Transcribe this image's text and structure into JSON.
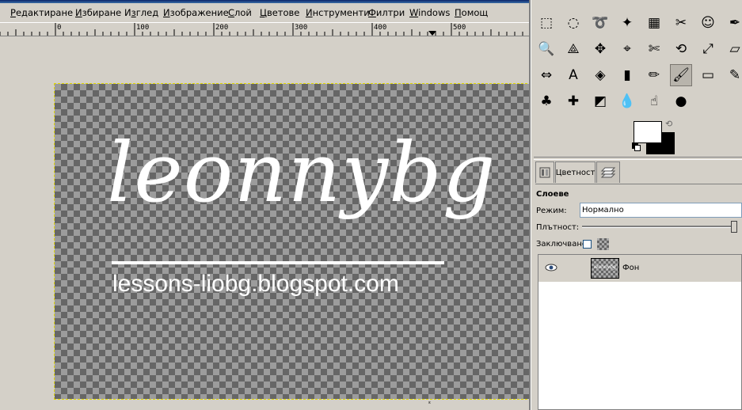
{
  "menubar": {
    "items": [
      {
        "label": "Редактиране",
        "mnemonic": "Р"
      },
      {
        "label": "Избиране",
        "mnemonic": "И"
      },
      {
        "label": "Изглед",
        "mnemonic": "з"
      },
      {
        "label": "Изображение",
        "mnemonic": "И"
      },
      {
        "label": "Слой",
        "mnemonic": "С"
      },
      {
        "label": "Цветове",
        "mnemonic": "Ц"
      },
      {
        "label": "Инструменти",
        "mnemonic": "И"
      },
      {
        "label": "Филтри",
        "mnemonic": "Ф"
      },
      {
        "label": "Windows",
        "mnemonic": "W"
      },
      {
        "label": "Помощ",
        "mnemonic": "П"
      }
    ]
  },
  "ruler": {
    "labels": [
      "0",
      "100",
      "200",
      "300",
      "400",
      "500"
    ]
  },
  "canvas": {
    "logo_text": "leonnybg",
    "url_text": "lessons-liobg.blogspot.com"
  },
  "toolbox": {
    "tools": [
      {
        "name": "rect-select-icon",
        "glyph": "⬚"
      },
      {
        "name": "ellipse-select-icon",
        "glyph": "◌"
      },
      {
        "name": "lasso-icon",
        "glyph": "➰"
      },
      {
        "name": "fuzzy-select-icon",
        "glyph": "✦"
      },
      {
        "name": "select-by-color-icon",
        "glyph": "▦"
      },
      {
        "name": "scissors-icon",
        "glyph": "✂"
      },
      {
        "name": "foreground-select-icon",
        "glyph": "☺"
      },
      {
        "name": "paths-icon",
        "glyph": "✒"
      },
      {
        "name": "magnify-icon",
        "glyph": "🔍"
      },
      {
        "name": "measure-icon",
        "glyph": "⟁"
      },
      {
        "name": "move-icon",
        "glyph": "✥"
      },
      {
        "name": "align-icon",
        "glyph": "⌖"
      },
      {
        "name": "crop-icon",
        "glyph": "✄"
      },
      {
        "name": "rotate-icon",
        "glyph": "⟲"
      },
      {
        "name": "scale-icon",
        "glyph": "⤢"
      },
      {
        "name": "shear-icon",
        "glyph": "▱"
      },
      {
        "name": "flip-icon",
        "glyph": "⇔"
      },
      {
        "name": "text-icon",
        "glyph": "A"
      },
      {
        "name": "bucket-fill-icon",
        "glyph": "◈"
      },
      {
        "name": "blend-icon",
        "glyph": "▮"
      },
      {
        "name": "pencil-icon",
        "glyph": "✏"
      },
      {
        "name": "paintbrush-icon",
        "glyph": "🖌"
      },
      {
        "name": "eraser-icon",
        "glyph": "▭"
      },
      {
        "name": "airbrush-icon",
        "glyph": "✎"
      },
      {
        "name": "clone-icon",
        "glyph": "♣"
      },
      {
        "name": "heal-icon",
        "glyph": "✚"
      },
      {
        "name": "perspective-clone-icon",
        "glyph": "◩"
      },
      {
        "name": "blur-icon",
        "glyph": "💧"
      },
      {
        "name": "smudge-icon",
        "glyph": "☝"
      },
      {
        "name": "dodge-burn-icon",
        "glyph": "●"
      }
    ],
    "colors": {
      "foreground": "#ffffff",
      "background": "#000000"
    }
  },
  "layers_dock": {
    "tabs": [
      {
        "label": ""
      },
      {
        "label": "Цветност"
      },
      {
        "label": ""
      }
    ],
    "title": "Слоеве",
    "mode_label": "Режим:",
    "mode_value": "Нормално",
    "opacity_label": "Плътност:",
    "opacity_value": 100,
    "lock_label": "Заключване:",
    "layers": [
      {
        "name": "Фон",
        "visible": true
      }
    ]
  }
}
